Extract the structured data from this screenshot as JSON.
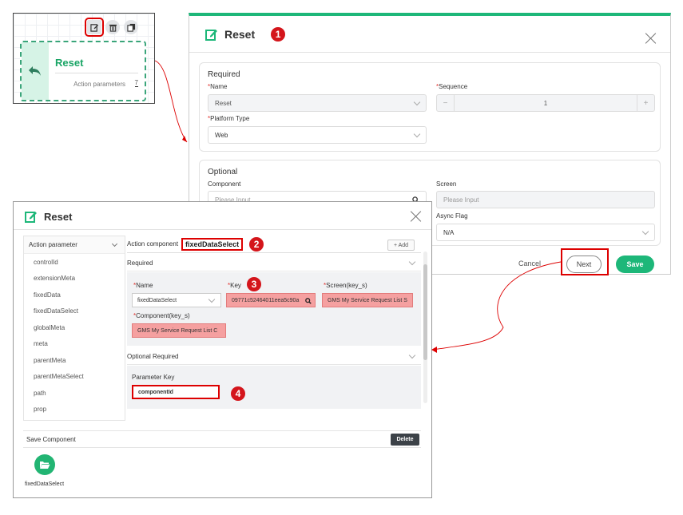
{
  "node": {
    "title": "Reset",
    "action_params_label": "Action parameters",
    "action_params_count": "7",
    "tools": [
      "edit-icon",
      "delete-icon",
      "copy-icon"
    ]
  },
  "big_dialog": {
    "title": "Reset",
    "marker": "1",
    "required": {
      "section_title": "Required",
      "name_label": "*Name",
      "name_value": "Reset",
      "sequence_label": "*Sequence",
      "sequence_value": "1",
      "platform_label": "*Platform Type",
      "platform_value": "Web"
    },
    "optional": {
      "section_title": "Optional",
      "component_label": "Component",
      "component_placeholder": "Please Input",
      "screen_label": "Screen",
      "screen_placeholder": "Please Input",
      "async_label": "Async Flag",
      "async_value": "N/A"
    },
    "buttons": {
      "cancel": "Cancel",
      "next": "Next",
      "save": "Save"
    }
  },
  "small_dialog": {
    "title": "Reset",
    "sidebar": {
      "header": "Action parameter",
      "items": [
        "controlId",
        "extensionMeta",
        "fixedData",
        "fixedDataSelect",
        "globalMeta",
        "meta",
        "parentMeta",
        "parentMetaSelect",
        "path",
        "prop"
      ]
    },
    "action_component_label": "Action component",
    "action_component_value": "fixedDataSelect",
    "marker2": "2",
    "add_button": "+ Add",
    "required": {
      "header": "Required",
      "name_label": "*Name",
      "name_value": "fixedDataSelect",
      "key_label": "*Key",
      "key_value": "09771c52464011eea5c90a",
      "marker3": "3",
      "screen_label": "*Screen(key_s)",
      "screen_value": "GMS My Service Request List S",
      "component_label": "*Component(key_s)",
      "component_value": "GMS My Service Request List C"
    },
    "optional_required": {
      "header": "Optional Required",
      "param_key_label": "Parameter Key",
      "param_key_value": "componentId",
      "marker4": "4"
    },
    "save_component": {
      "label": "Save Component",
      "delete_button": "Delete",
      "item_label": "fixedDataSelect"
    }
  },
  "colors": {
    "accent": "#1db779",
    "highlight": "#d00000",
    "required_field": "#f5a0a0"
  }
}
